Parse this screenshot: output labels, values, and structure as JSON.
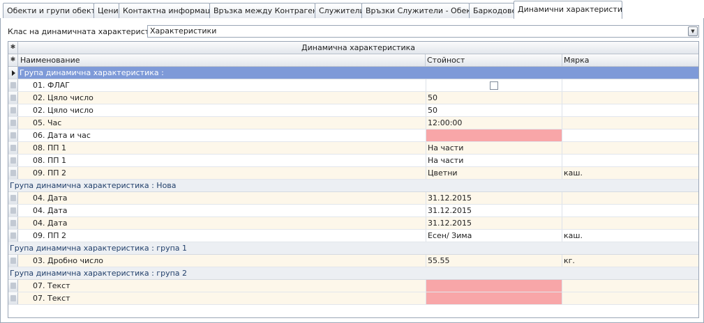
{
  "tabs": [
    {
      "label": "Обекти и групи обекти"
    },
    {
      "label": "Цени"
    },
    {
      "label": "Контактна информация"
    },
    {
      "label": "Връзка между Контрагенти"
    },
    {
      "label": "Служители"
    },
    {
      "label": "Връзки Служители - Обекти"
    },
    {
      "label": "Баркодове"
    },
    {
      "label": "Динамични характеристики"
    }
  ],
  "active_tab": "Динамични характеристики",
  "class_field": {
    "label": "Клас на динамичната характеристика",
    "value": "Характеристики"
  },
  "grid": {
    "band_title": "Динамична характеристика",
    "columns": {
      "name": "Наименование",
      "value": "Стойност",
      "unit": "Мярка"
    },
    "groups": [
      {
        "label": "Група динамична характеристика :"
      },
      {
        "label": "Група динамична характеристика : Нова"
      },
      {
        "label": "Група динамична характеристика : група 1"
      },
      {
        "label": "Група динамична характеристика : група 2"
      }
    ],
    "rows": [
      {
        "name": "01. ФЛАГ",
        "value": "",
        "unit": "",
        "checkbox_checked": false
      },
      {
        "name": "02. Цяло число",
        "value": "50",
        "unit": ""
      },
      {
        "name": "02. Цяло число",
        "value": "50",
        "unit": ""
      },
      {
        "name": "05. Час",
        "value": "12:00:00",
        "unit": ""
      },
      {
        "name": "06. Дата и час",
        "value": "",
        "unit": ""
      },
      {
        "name": "08. ПП 1",
        "value": "На части",
        "unit": ""
      },
      {
        "name": "08. ПП 1",
        "value": "На части",
        "unit": ""
      },
      {
        "name": "09. ПП 2",
        "value": "Цветни",
        "unit": "каш."
      },
      {
        "name": "04. Дата",
        "value": "31.12.2015",
        "unit": ""
      },
      {
        "name": "04. Дата",
        "value": "31.12.2015",
        "unit": ""
      },
      {
        "name": "04. Дата",
        "value": "31.12.2015",
        "unit": ""
      },
      {
        "name": "09. ПП 2",
        "value": "Есен/ Зима",
        "unit": "каш."
      },
      {
        "name": "03. Дробно число",
        "value": "55.55",
        "unit": "кг."
      },
      {
        "name": "07. Текст",
        "value": "",
        "unit": ""
      },
      {
        "name": "07. Текст",
        "value": "",
        "unit": ""
      }
    ]
  },
  "colors": {
    "selected_group": "#7e9ad8",
    "required_empty": "#f8a6a8",
    "alt_row": "#fdf7ea"
  }
}
